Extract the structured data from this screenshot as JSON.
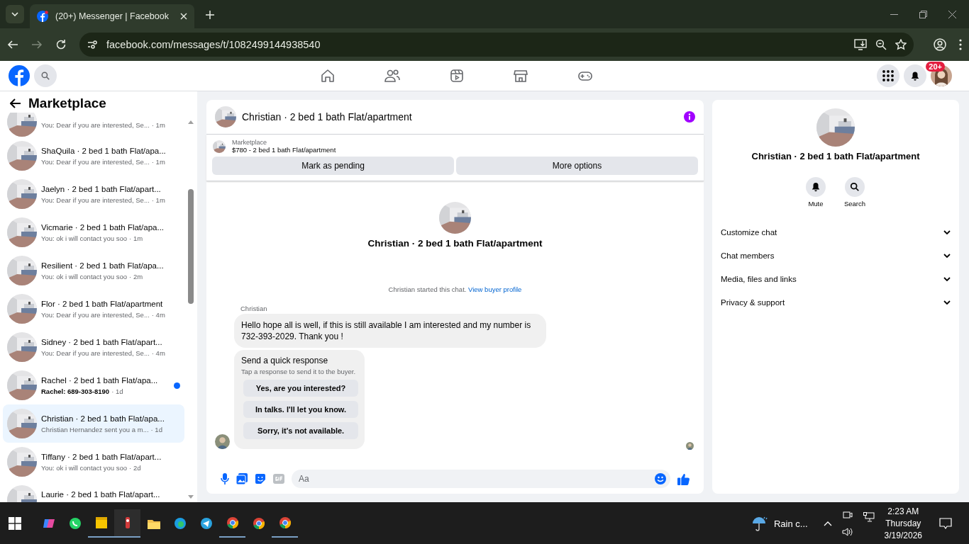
{
  "browser": {
    "tab": {
      "title": "(20+) Messenger | Facebook",
      "selected": true
    },
    "url": "facebook.com/messages/t/1082499144938540"
  },
  "header": {
    "notification_badge": "20+"
  },
  "sidebar": {
    "title": "Marketplace",
    "conversations": [
      {
        "kind": "partial",
        "preview": "You: Dear if you are interested, Se...",
        "time": "· 1m",
        "unread": false,
        "selected": false
      },
      {
        "kind": "full",
        "title": "ShaQuila · 2 bed 1 bath Flat/apa...",
        "preview": "You: Dear if you are interested, Se...",
        "time": "· 1m",
        "unread": false,
        "selected": false
      },
      {
        "kind": "full",
        "title": "Jaelyn · 2 bed 1 bath Flat/apart...",
        "preview": "You: Dear if you are interested, Se...",
        "time": "· 1m",
        "unread": false,
        "selected": false
      },
      {
        "kind": "full",
        "title": "Vicmarie · 2 bed 1 bath Flat/apa...",
        "preview": "You: ok i will contact you soo",
        "time": "· 1m",
        "unread": false,
        "selected": false
      },
      {
        "kind": "full",
        "title": "Resilient · 2 bed 1 bath Flat/apa...",
        "preview": "You: ok i will contact you soo",
        "time": "· 2m",
        "unread": false,
        "selected": false
      },
      {
        "kind": "full",
        "title": "Flor · 2 bed 1 bath Flat/apartment",
        "preview": "You: Dear if you are interested, Se...",
        "time": "· 4m",
        "unread": false,
        "selected": false
      },
      {
        "kind": "full",
        "title": "Sidney · 2 bed 1 bath Flat/apart...",
        "preview": "You: Dear if you are interested, Se...",
        "time": "· 4m",
        "unread": false,
        "selected": false
      },
      {
        "kind": "full",
        "title": "Rachel · 2 bed 1 bath Flat/apa...",
        "preview": "Rachel: 689-303-8190",
        "time": "· 1d",
        "unread": true,
        "selected": false
      },
      {
        "kind": "full",
        "title": "Christian · 2 bed 1 bath Flat/apa...",
        "preview": "Christian Hernandez sent you a m...",
        "time": "· 1d",
        "unread": false,
        "selected": true
      },
      {
        "kind": "full",
        "title": "Tiffany · 2 bed 1 bath Flat/apart...",
        "preview": "You: ok i will contact you soo",
        "time": "· 2d",
        "unread": false,
        "selected": false
      },
      {
        "kind": "cut",
        "title": "Laurie · 2 bed 1 bath Flat/apart...",
        "unread": false,
        "selected": false
      }
    ]
  },
  "chat": {
    "title": "Christian · 2 bed 1 bath Flat/apartment",
    "listing": {
      "label": "Marketplace",
      "price_title": "$780 - 2 bed 1 bath Flat/apartment"
    },
    "actions": [
      "Mark as pending",
      "More options"
    ],
    "intro_title": "Christian · 2 bed 1 bath Flat/apartment",
    "system_text": "Christian started this chat.",
    "system_link": "View buyer profile",
    "sender": "Christian",
    "message": "Hello hope all is well, if this is still available I am interested and my number is 732-393-2029. Thank you !",
    "quick_response": {
      "title": "Send a quick response",
      "subtitle": "Tap a response to send it to the buyer.",
      "options": [
        "Yes, are you interested?",
        "In talks. I'll let you know.",
        "Sorry, it's not available."
      ]
    },
    "composer": {
      "placeholder": "Aa"
    }
  },
  "details": {
    "title": "Christian · 2 bed 1 bath Flat/apartment",
    "actions": [
      {
        "kind": "mute",
        "label": "Mute"
      },
      {
        "kind": "search",
        "label": "Search"
      }
    ],
    "sections": [
      "Customize chat",
      "Chat members",
      "Media, files and links",
      "Privacy & support"
    ]
  },
  "taskbar": {
    "weather": "Rain c...",
    "time": "2:23 AM",
    "day": "Thursday",
    "date": "3/19/2026"
  }
}
